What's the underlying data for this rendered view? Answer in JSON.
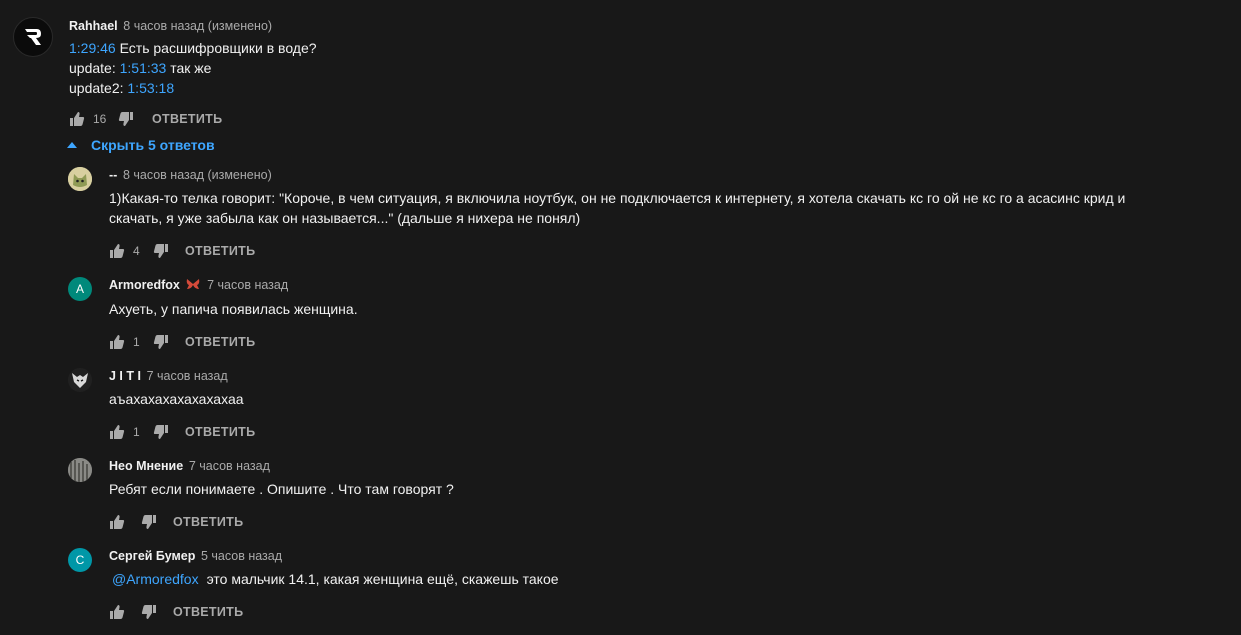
{
  "main_comment": {
    "author": "Rahhael",
    "time": "8 часов назад (изменено)",
    "line1": {
      "ts": "1:29:46",
      "text": " Есть расшифровщики в воде?"
    },
    "line2": {
      "prefix": "update: ",
      "ts": "1:51:33",
      "text": " так же"
    },
    "line3": {
      "prefix": "update2: ",
      "ts": "1:53:18"
    },
    "likes": "16",
    "reply_label": "ОТВЕТИТЬ"
  },
  "replies_toggle": {
    "label": "Скрыть 5 ответов"
  },
  "replies": [
    {
      "author": "--",
      "time": "8 часов назад (изменено)",
      "text1": "1)Какая-то телка говорит: \"Короче, в чем ситуация, я включила ноутбук, он не подключается к интернету, я хотела скачать кс го ой не кс го а асасинс крид и",
      "text2": "скачать, я уже забыла как он называется...\" (дальше я нихера не понял)",
      "likes": "4",
      "reply_label": "ОТВЕТИТЬ"
    },
    {
      "author": "Armoredfox",
      "avatar_letter": "A",
      "time": "7 часов назад",
      "text1": "Ахуеть, у папича появилась женщина.",
      "likes": "1",
      "reply_label": "ОТВЕТИТЬ"
    },
    {
      "author": "J I T I",
      "time": "7 часов назад",
      "text1": "аъахахахахахахахаа",
      "likes": "1",
      "reply_label": "ОТВЕТИТЬ"
    },
    {
      "author": "Нео Мнение",
      "time": "7 часов назад",
      "text1": "Ребят если понимаете . Опишите . Что там говорят ?",
      "likes": "",
      "reply_label": "ОТВЕТИТЬ"
    },
    {
      "author": "Сергей Бумер",
      "avatar_letter": "С",
      "time": "5 часов назад",
      "mention": "@Armoredfox",
      "text1": "это мальчик 14.1, какая женщина ещё, скажешь такое",
      "likes": "",
      "reply_label": "ОТВЕТИТЬ"
    }
  ],
  "colors": {
    "background": "#181818",
    "link": "#3ea6ff",
    "secondary_text": "#aaaaaa",
    "avatar_teal": "#00897b",
    "avatar_cyan": "#0097a7"
  }
}
